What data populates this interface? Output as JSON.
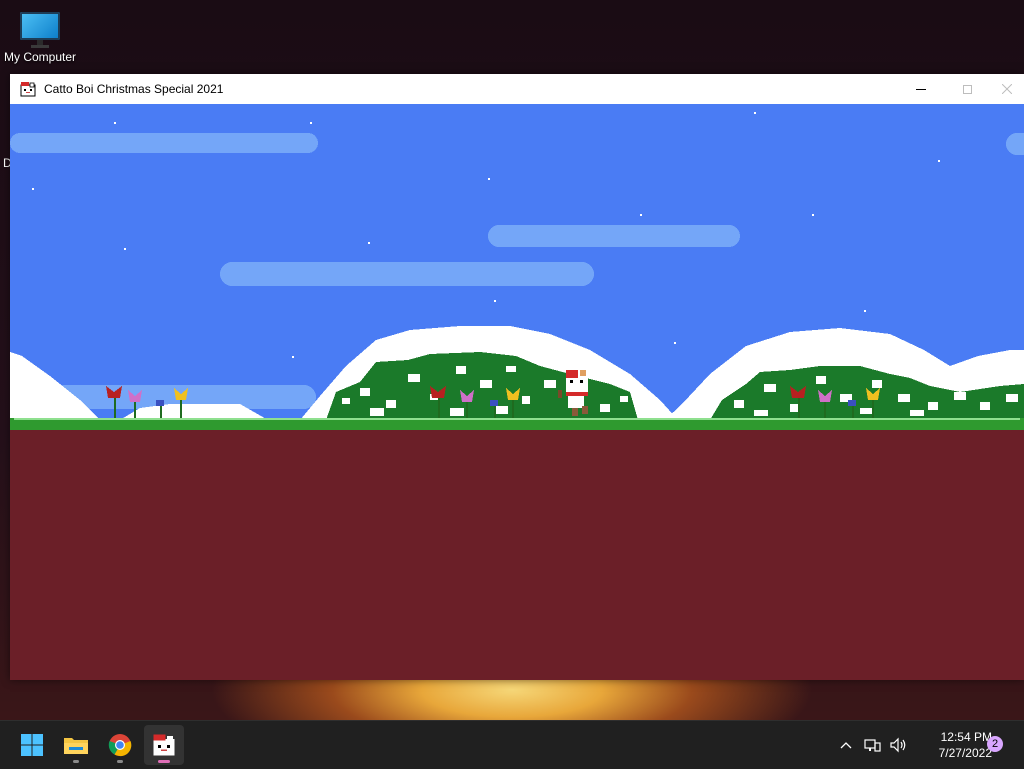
{
  "desktop": {
    "icons": [
      {
        "label": "My Computer",
        "icon": "monitor-icon"
      }
    ],
    "stray_text": "D"
  },
  "window": {
    "title": "Catto Boi Christmas Special 2021",
    "controls": [
      "minimize",
      "maximize",
      "close"
    ],
    "game": {
      "sky_color": "#4a7cf4",
      "cloud_color": "#74a6f8",
      "hill_color": "#ffffff",
      "bush_color": "#1b7a2a",
      "ground_color": "#6b1f28",
      "grass_color": "#2f9a2f"
    }
  },
  "taskbar": {
    "apps": [
      {
        "name": "start",
        "icon": "windows-logo-icon"
      },
      {
        "name": "file-explorer",
        "icon": "folder-icon"
      },
      {
        "name": "chrome",
        "icon": "chrome-icon"
      },
      {
        "name": "catto-boi",
        "icon": "catto-boi-icon",
        "active": true
      }
    ],
    "tray_icons": [
      "chevron-up-icon",
      "network-icon",
      "volume-icon"
    ],
    "clock": {
      "time": "12:54 PM",
      "date": "7/27/2022"
    },
    "notification_count": "2"
  }
}
